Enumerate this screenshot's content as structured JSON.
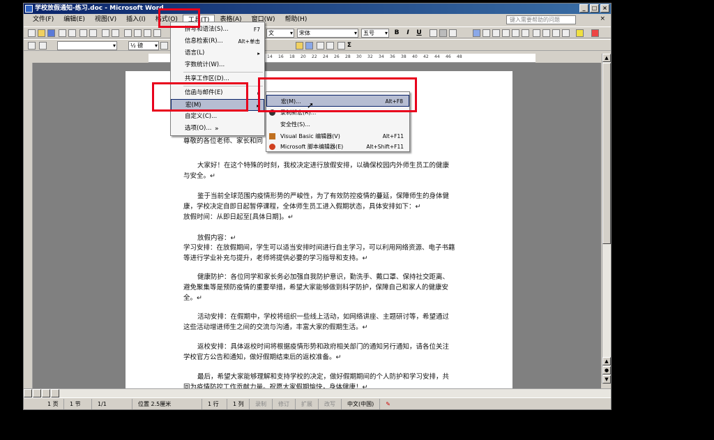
{
  "window": {
    "title": "学校放假通知-练习.doc - Microsoft Word",
    "controls": [
      "_",
      "□",
      "×"
    ]
  },
  "menubar": {
    "items": [
      "文件(F)",
      "编辑(E)",
      "视图(V)",
      "插入(I)",
      "格式(O)",
      "工具(T)",
      "表格(A)",
      "窗口(W)",
      "帮助(H)"
    ],
    "help_placeholder": "键入需要帮助的问题",
    "close": "×"
  },
  "toolbar": {
    "style_value": "文",
    "font_value": "宋体",
    "size_value": "五号",
    "bold": "B",
    "italic": "I",
    "underline": "U",
    "line_combo": "½ 磅",
    "sigma": "Σ"
  },
  "ruler": {
    "numbers": [
      "14",
      "16",
      "18",
      "20",
      "22",
      "24",
      "26",
      "28",
      "30",
      "32",
      "34",
      "36",
      "38",
      "40",
      "42",
      "44",
      "46",
      "48"
    ]
  },
  "tools_menu": {
    "items": [
      {
        "label": "拼写和语法(S)...",
        "shortcut": "F7"
      },
      {
        "label": "信息检索(R)...",
        "shortcut": "Alt+单击"
      },
      {
        "label": "语言(L)",
        "shortcut": "▸"
      },
      {
        "label": "字数统计(W)...",
        "shortcut": ""
      },
      {
        "label": "共享工作区(D)...",
        "shortcut": ""
      },
      {
        "label": "信函与邮件(E)",
        "shortcut": "▸"
      },
      {
        "label": "宏(M)",
        "shortcut": "▸"
      },
      {
        "label": "自定义(C)...",
        "shortcut": ""
      },
      {
        "label": "选项(O)...",
        "shortcut": ""
      },
      {
        "label": "»",
        "shortcut": ""
      }
    ]
  },
  "macro_submenu": {
    "items": [
      {
        "label": "宏(M)...",
        "shortcut": "Alt+F8"
      },
      {
        "label": "录制新宏(R)...",
        "shortcut": ""
      },
      {
        "label": "安全性(S)...",
        "shortcut": ""
      },
      {
        "label": "Visual Basic 编辑器(V)",
        "shortcut": "Alt+F11"
      },
      {
        "label": "Microsoft 脚本编辑器(E)",
        "shortcut": "Alt+Shift+F11"
      }
    ]
  },
  "document": {
    "paragraphs": [
      "尊敬的各位老师、家长和同",
      "大家好！在这个特殊的时刻，我校决定进行放假安排，以确保校园内外师生员工的健康与安全。↵",
      "鉴于当前全球范围内疫情形势的严峻性，为了有效防控疫情的蔓延，保障师生的身体健康，学校决定自即日起暂停课程，全体师生员工进入假期状态，具体安排如下：↵",
      "放假时间：从即日起至[具体日期]。↵",
      "放假内容：↵",
      "学习安排：在放假期间，学生可以适当安排时间进行自主学习，可以利用网络资源、电子书籍等进行学业补充与提升，老师将提供必要的学习指导和支持。↵",
      "健康防护：各位同学和家长务必加强自我防护意识，勤洗手、戴口罩、保持社交距离、避免聚集等是预防疫情的重要举措，希望大家能够做到科学防护，保障自己和家人的健康安全。↵",
      "活动安排：在假期中，学校将组织一些线上活动，如网络讲座、主题研讨等，希望通过这些活动增进师生之间的交流与沟通，丰富大家的假期生活。↵",
      "返校安排：具体返校时间将根据疫情形势和政府相关部门的通知另行通知，请各位关注学校官方公告和通知，做好假期结束后的返校准备。↵",
      "最后，希望大家能够理解和支持学校的决定，做好假期期间的个人防护和学习安排，共同为疫情防控工作贡献力量。祝愿大家假期愉快，身体健康！↵"
    ]
  },
  "statusbar": {
    "page": "1 页",
    "section": "1 节",
    "pages": "1/1",
    "position": "位置 2.5厘米",
    "line": "1 行",
    "col": "1 列",
    "rec": "录制",
    "trk": "修订",
    "ext": "扩展",
    "ovr": "改写",
    "lang": "中文(中国)"
  }
}
